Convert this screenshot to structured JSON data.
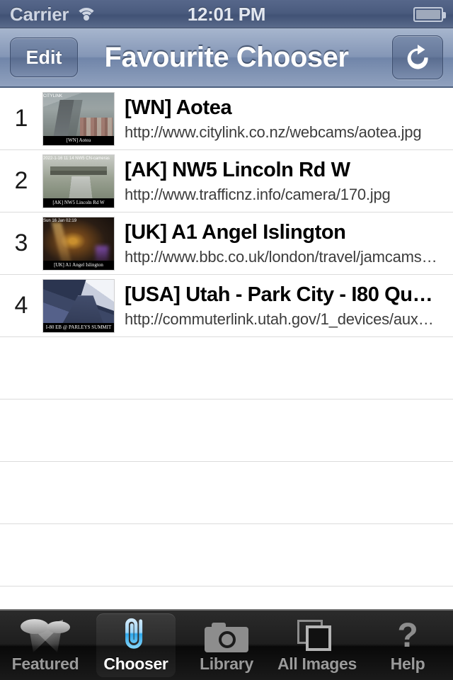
{
  "status_bar": {
    "carrier": "Carrier",
    "wifi_icon": "wifi-icon",
    "time": "12:01 PM",
    "battery_icon": "battery-icon"
  },
  "nav_bar": {
    "edit_label": "Edit",
    "title": "Favourite Chooser",
    "refresh_icon": "refresh-icon"
  },
  "list": {
    "rows": [
      {
        "rank": "1",
        "title": "[WN] Aotea",
        "url": "http://www.citylink.co.nz/webcams/aotea.jpg",
        "thumb_header": "CITYLINK",
        "thumb_caption": "[WN] Aotea"
      },
      {
        "rank": "2",
        "title": "[AK] NW5 Lincoln Rd W",
        "url": "http://www.trafficnz.info/camera/170.jpg",
        "thumb_header": "2022-1-16 11:14      NW5 CN-cameras",
        "thumb_caption": "[AK] NW5 Lincoln Rd W"
      },
      {
        "rank": "3",
        "title": "[UK] A1 Angel Islington",
        "url": "http://www.bbc.co.uk/london/travel/jamcams…",
        "thumb_header": "Sun 16 Jan 02:19",
        "thumb_caption": "[UK] A1 Angel Islington"
      },
      {
        "rank": "4",
        "title": "[USA] Utah - Park City - I80 Qua…",
        "url": "http://commuterlink.utah.gov/1_devices/aux7…",
        "thumb_header": "",
        "thumb_caption": "I-80 EB @ PARLEYS SUMMIT"
      }
    ],
    "empty_row_count": 5
  },
  "tab_bar": {
    "tabs": [
      {
        "label": "Featured",
        "icon": "spotlights-icon",
        "active": false
      },
      {
        "label": "Chooser",
        "icon": "paperclip-icon",
        "active": true
      },
      {
        "label": "Library",
        "icon": "camera-icon",
        "active": false
      },
      {
        "label": "All Images",
        "icon": "photos-stack-icon",
        "active": false
      },
      {
        "label": "Help",
        "icon": "question-mark-icon",
        "active": false
      }
    ]
  },
  "colors": {
    "navbar_blue": "#8496b6",
    "statusbar_blue": "#4a5b7e",
    "accent_blue": "#3fb2f0",
    "tabbar_black": "#1e1e1e",
    "separator": "#dcdcdc"
  }
}
